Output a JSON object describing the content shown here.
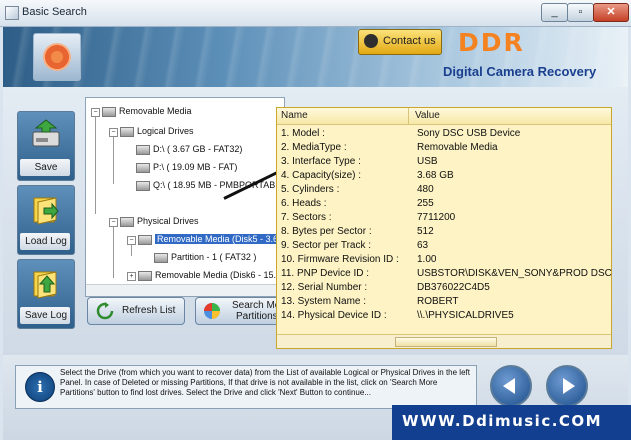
{
  "window": {
    "title": "Basic Search",
    "min_glyph": "_",
    "max_glyph": "▫",
    "close_glyph": "✕"
  },
  "header": {
    "contact_label": "Contact us",
    "brand": "DDR",
    "product": "Digital Camera Recovery"
  },
  "sidebar": {
    "save_label": "Save",
    "load_label": "Load Log",
    "savelog_label": "Save Log"
  },
  "tree": {
    "root": "Removable Media",
    "logical": "Logical Drives",
    "d_drive": "D:\\ ( 3.67 GB - FAT32)",
    "p_drive": "P:\\ ( 19.09 MB - FAT)",
    "q_drive": "Q:\\ ( 18.95 MB - PMBPORTABLE",
    "physical": "Physical Drives",
    "disk5": "Removable Media (Disk5 - 3.68",
    "partition": "Partition - 1 ( FAT32 )",
    "disk6": "Removable Media (Disk6 - 15.69"
  },
  "buttons": {
    "refresh": "Refresh List",
    "search_more": "Search More",
    "search_more2": "Partitions"
  },
  "properties": {
    "col_name": "Name",
    "col_value": "Value",
    "rows": [
      {
        "k": "1. Model :",
        "v": "Sony DSC USB Device"
      },
      {
        "k": "2. MediaType :",
        "v": "Removable Media"
      },
      {
        "k": "3. Interface Type :",
        "v": "USB"
      },
      {
        "k": "4. Capacity(size) :",
        "v": "3.68 GB"
      },
      {
        "k": "5. Cylinders :",
        "v": "480"
      },
      {
        "k": "6. Heads :",
        "v": "255"
      },
      {
        "k": "7. Sectors :",
        "v": "7711200"
      },
      {
        "k": "8. Bytes per Sector :",
        "v": "512"
      },
      {
        "k": "9. Sector per Track :",
        "v": "63"
      },
      {
        "k": "10. Firmware Revision ID :",
        "v": "1.00"
      },
      {
        "k": "11. PNP Device ID :",
        "v": "USBSTOR\\DISK&VEN_SONY&PROD  DSC"
      },
      {
        "k": "12. Serial Number :",
        "v": "DB376022C4D5"
      },
      {
        "k": "13. System Name :",
        "v": "ROBERT"
      },
      {
        "k": "14. Physical Device ID :",
        "v": "\\\\.\\PHYSICALDRIVE5"
      }
    ]
  },
  "footer": {
    "info_glyph": "i",
    "info_text": "Select the Drive (from which you want to recover data) from the List of available Logical or Physical Drives in the left Panel. In case of Deleted or missing Partitions, If that drive is not available in the list, click on 'Search More Partitions' button to find lost drives. Select the Drive and click 'Next' Button to continue...",
    "watermark": "WWW.Ddimusic.COM"
  },
  "colors": {
    "brand": "#f58220",
    "accent": "#316ac5",
    "popup_bg": "#fdf3c4",
    "watermark_bg": "#123f8f"
  }
}
